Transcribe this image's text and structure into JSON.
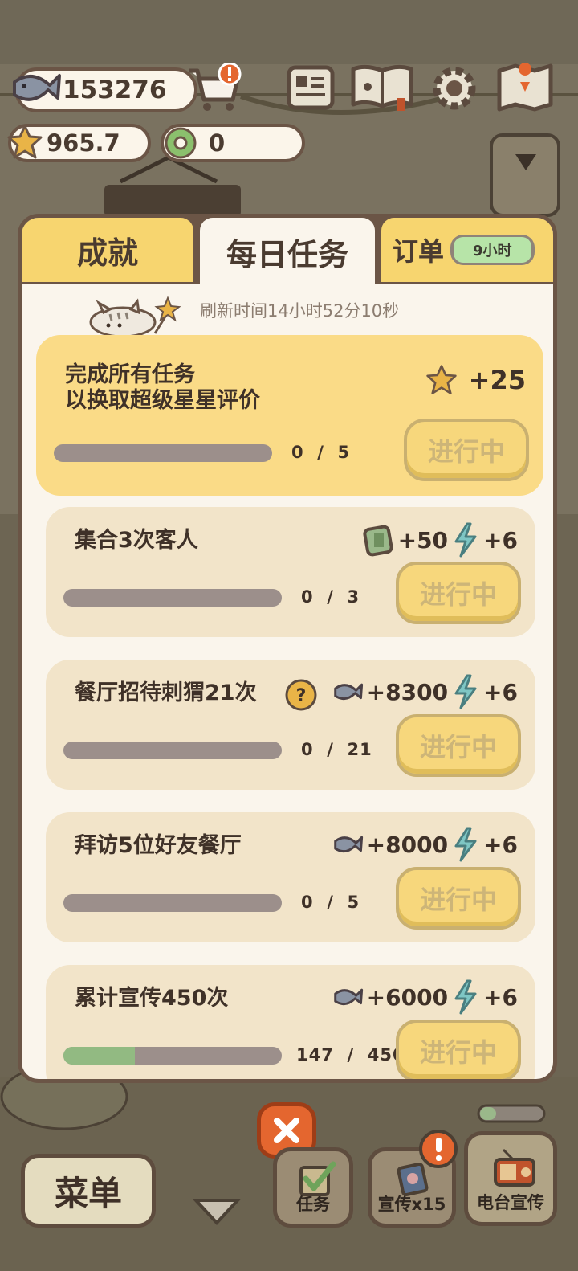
{
  "hud": {
    "fish_count": "153276",
    "star_rating": "965.7",
    "donut_count": "0"
  },
  "tabs": {
    "achievements": "成就",
    "daily": "每日任务",
    "orders": "订单",
    "orders_timer": "9小时"
  },
  "refresh_text": "刷新时间14小时52分10秒",
  "tasks": [
    {
      "name": "完成所有任务\n以换取超级星星评价",
      "progress": "0  /  5",
      "progress_fraction": 0,
      "reward_1": "+25",
      "reward_1_icon": "star-icon",
      "button": "进行中"
    },
    {
      "name": "集合3次客人",
      "progress": "0  /  3",
      "progress_fraction": 0,
      "reward_1": "+50",
      "reward_1_icon": "ticket-icon",
      "reward_2": "+6",
      "reward_2_icon": "lightning-icon",
      "button": "进行中"
    },
    {
      "name": "餐厅招待刺猬21次",
      "progress": "0  /  21",
      "progress_fraction": 0,
      "reward_1": "+8300",
      "reward_1_icon": "fish-icon",
      "reward_2": "+6",
      "reward_2_icon": "lightning-icon",
      "button": "进行中"
    },
    {
      "name": "拜访5位好友餐厅",
      "progress": "0  /  5",
      "progress_fraction": 0,
      "reward_1": "+8000",
      "reward_1_icon": "fish-icon",
      "reward_2": "+6",
      "reward_2_icon": "lightning-icon",
      "button": "进行中"
    },
    {
      "name": "累计宣传450次",
      "progress": "147  /  450",
      "progress_fraction": 0.327,
      "reward_1": "+6000",
      "reward_1_icon": "fish-icon",
      "reward_2": "+6",
      "reward_2_icon": "lightning-icon",
      "button": "进行中"
    }
  ],
  "bottom": {
    "menu": "菜单",
    "tasks": "任务",
    "promote": "宣传x15",
    "radio": "电台宣传"
  },
  "colors": {
    "panel_border": "#6b5546",
    "tab_yellow": "#f7d56f",
    "card_bg": "#f2e4c9",
    "highlight_bg": "#fadb87",
    "progress_fill": "#92ba82",
    "close_orange": "#e4662f"
  }
}
